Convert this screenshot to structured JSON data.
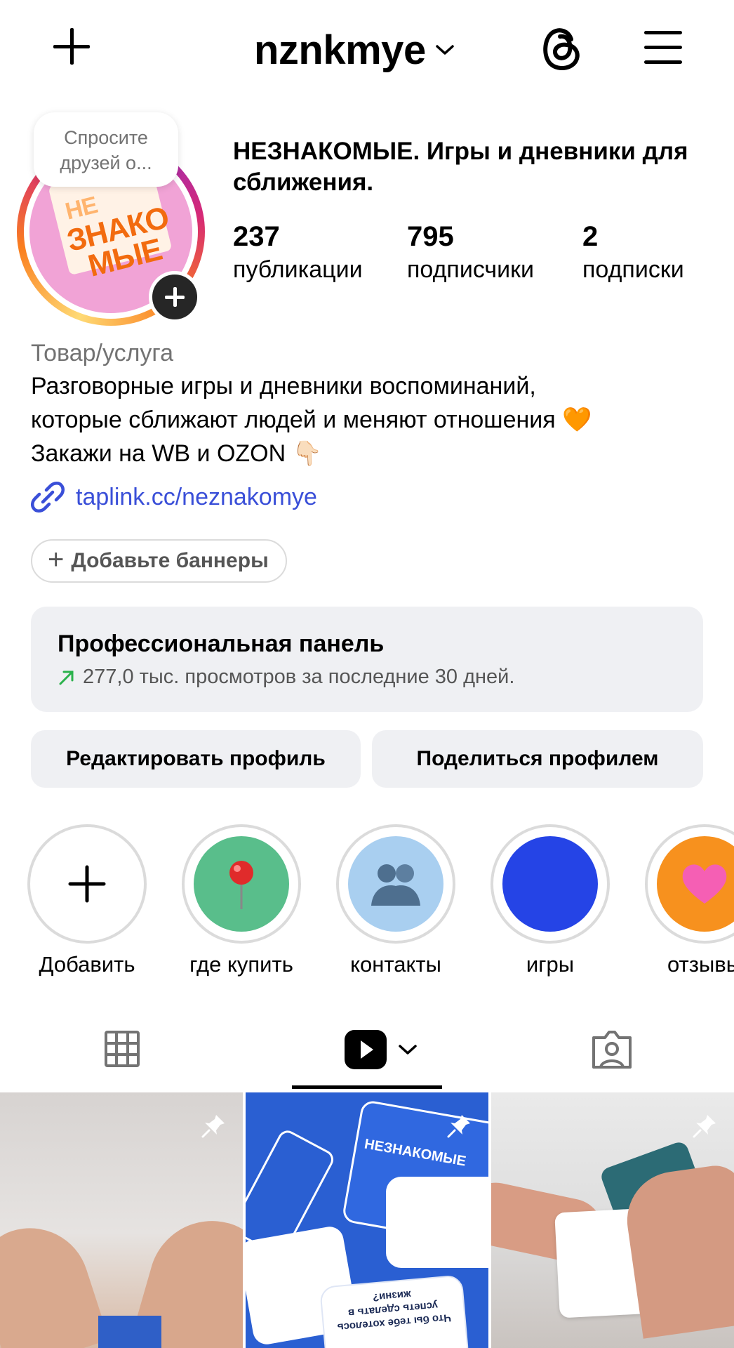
{
  "header": {
    "username": "nznkmye"
  },
  "profile": {
    "note": "Спросите друзей о...",
    "avatar_logo": [
      "НЕ",
      "ЗНАКО",
      "МЫЕ"
    ],
    "display_name": "НЕЗНАКОМЫЕ. Игры и дневники для сближения.",
    "stats": [
      {
        "value": "237",
        "label": "публикации"
      },
      {
        "value": "795",
        "label": "подписчики"
      },
      {
        "value": "2",
        "label": "подписки"
      }
    ],
    "category": "Товар/услуга",
    "bio_lines": [
      "Разговорные игры и дневники воспоминаний,",
      "которые сближают людей и меняют отношения 🧡",
      "Закажи на WB и OZON 👇🏻"
    ],
    "link": "taplink.cc/neznakomye",
    "add_banners": "Добавьте баннеры"
  },
  "pro_panel": {
    "title": "Профессиональная панель",
    "subtitle": "277,0 тыс. просмотров за последние 30 дней."
  },
  "actions": {
    "edit_profile": "Редактировать профиль",
    "share_profile": "Поделиться профилем"
  },
  "highlights": [
    {
      "label": "Добавить",
      "icon": "plus-icon"
    },
    {
      "label": "где купить",
      "icon": "pushpin-icon",
      "color": "#59be8b"
    },
    {
      "label": "контакты",
      "icon": "people-hugging-icon",
      "color": "#a9cff0"
    },
    {
      "label": "игры",
      "icon": "none",
      "color": "#2544e6"
    },
    {
      "label": "отзывы",
      "icon": "pink-heart-icon",
      "color": "#f7911e"
    }
  ],
  "tabs": [
    "grid-icon",
    "reels-icon",
    "tagged-icon"
  ],
  "colors": {
    "link": "#3a4fd8",
    "panel_bg": "#eff0f3",
    "avatar_orange": "#f26b0f",
    "avatar_pink": "#f1a3d6",
    "trend_green": "#2bb24c"
  },
  "tiles": [
    {
      "name": "tile-hands-box",
      "pinned": true
    },
    {
      "name": "tile-blue-cards",
      "pinned": true,
      "card_brand": "НЕЗНАКОМЫЕ",
      "card_text": "Что бы тебе хотелось успеть сделать в жизни?"
    },
    {
      "name": "tile-hands-card",
      "pinned": true
    }
  ]
}
